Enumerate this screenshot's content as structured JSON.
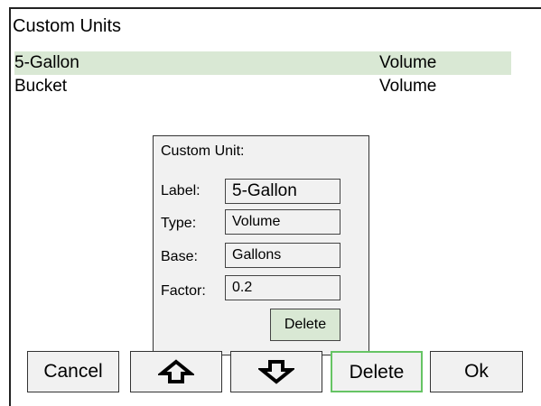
{
  "screen": {
    "title": "Custom Units"
  },
  "units": [
    {
      "name": "5-Gallon",
      "type": "Volume",
      "selected": true
    },
    {
      "name": "Bucket",
      "type": "Volume",
      "selected": false
    }
  ],
  "dialog": {
    "title": "Custom Unit:",
    "label_caption": "Label:",
    "label_value": "5-Gallon",
    "type_caption": "Type:",
    "type_value": "Volume",
    "base_caption": "Base:",
    "base_value": "Gallons",
    "factor_caption": "Factor:",
    "factor_value": "0.2",
    "delete_label": "Delete"
  },
  "toolbar": {
    "cancel_label": "Cancel",
    "up_icon": "arrow-up-icon",
    "down_icon": "arrow-down-icon",
    "delete_label": "Delete",
    "ok_label": "Ok"
  },
  "colors": {
    "selected_row": "#d9e8d4",
    "highlight_border": "#66c464",
    "panel_bg": "#f1f1f1"
  }
}
